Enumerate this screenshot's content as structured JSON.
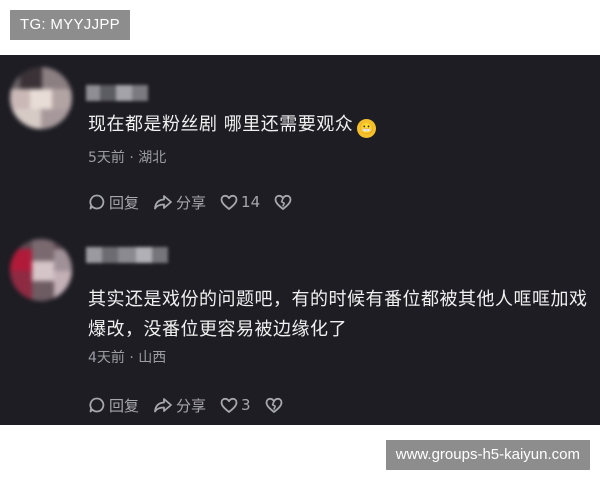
{
  "watermarks": {
    "top": "TG: MYYJJPP",
    "bottom": "www.groups-h5-kaiyun.com"
  },
  "comments": [
    {
      "text": "现在都是粉丝剧 哪里还需要观众",
      "has_emoji": true,
      "emoji": "grimacing-face-emoji",
      "meta": "5天前 · 湖北",
      "reply_label": "回复",
      "share_label": "分享",
      "like_count": "14"
    },
    {
      "text": "其实还是戏份的问题吧，有的时候有番位都被其他人哐哐加戏爆改，没番位更容易被边缘化了",
      "has_emoji": false,
      "meta": "4天前 · 山西",
      "reply_label": "回复",
      "share_label": "分享",
      "like_count": "3"
    }
  ],
  "colors": {
    "background": "#1d1d23",
    "text": "#f0f0f0",
    "meta": "#9c9ca4",
    "watermark_bg": "#8d8d8d"
  }
}
